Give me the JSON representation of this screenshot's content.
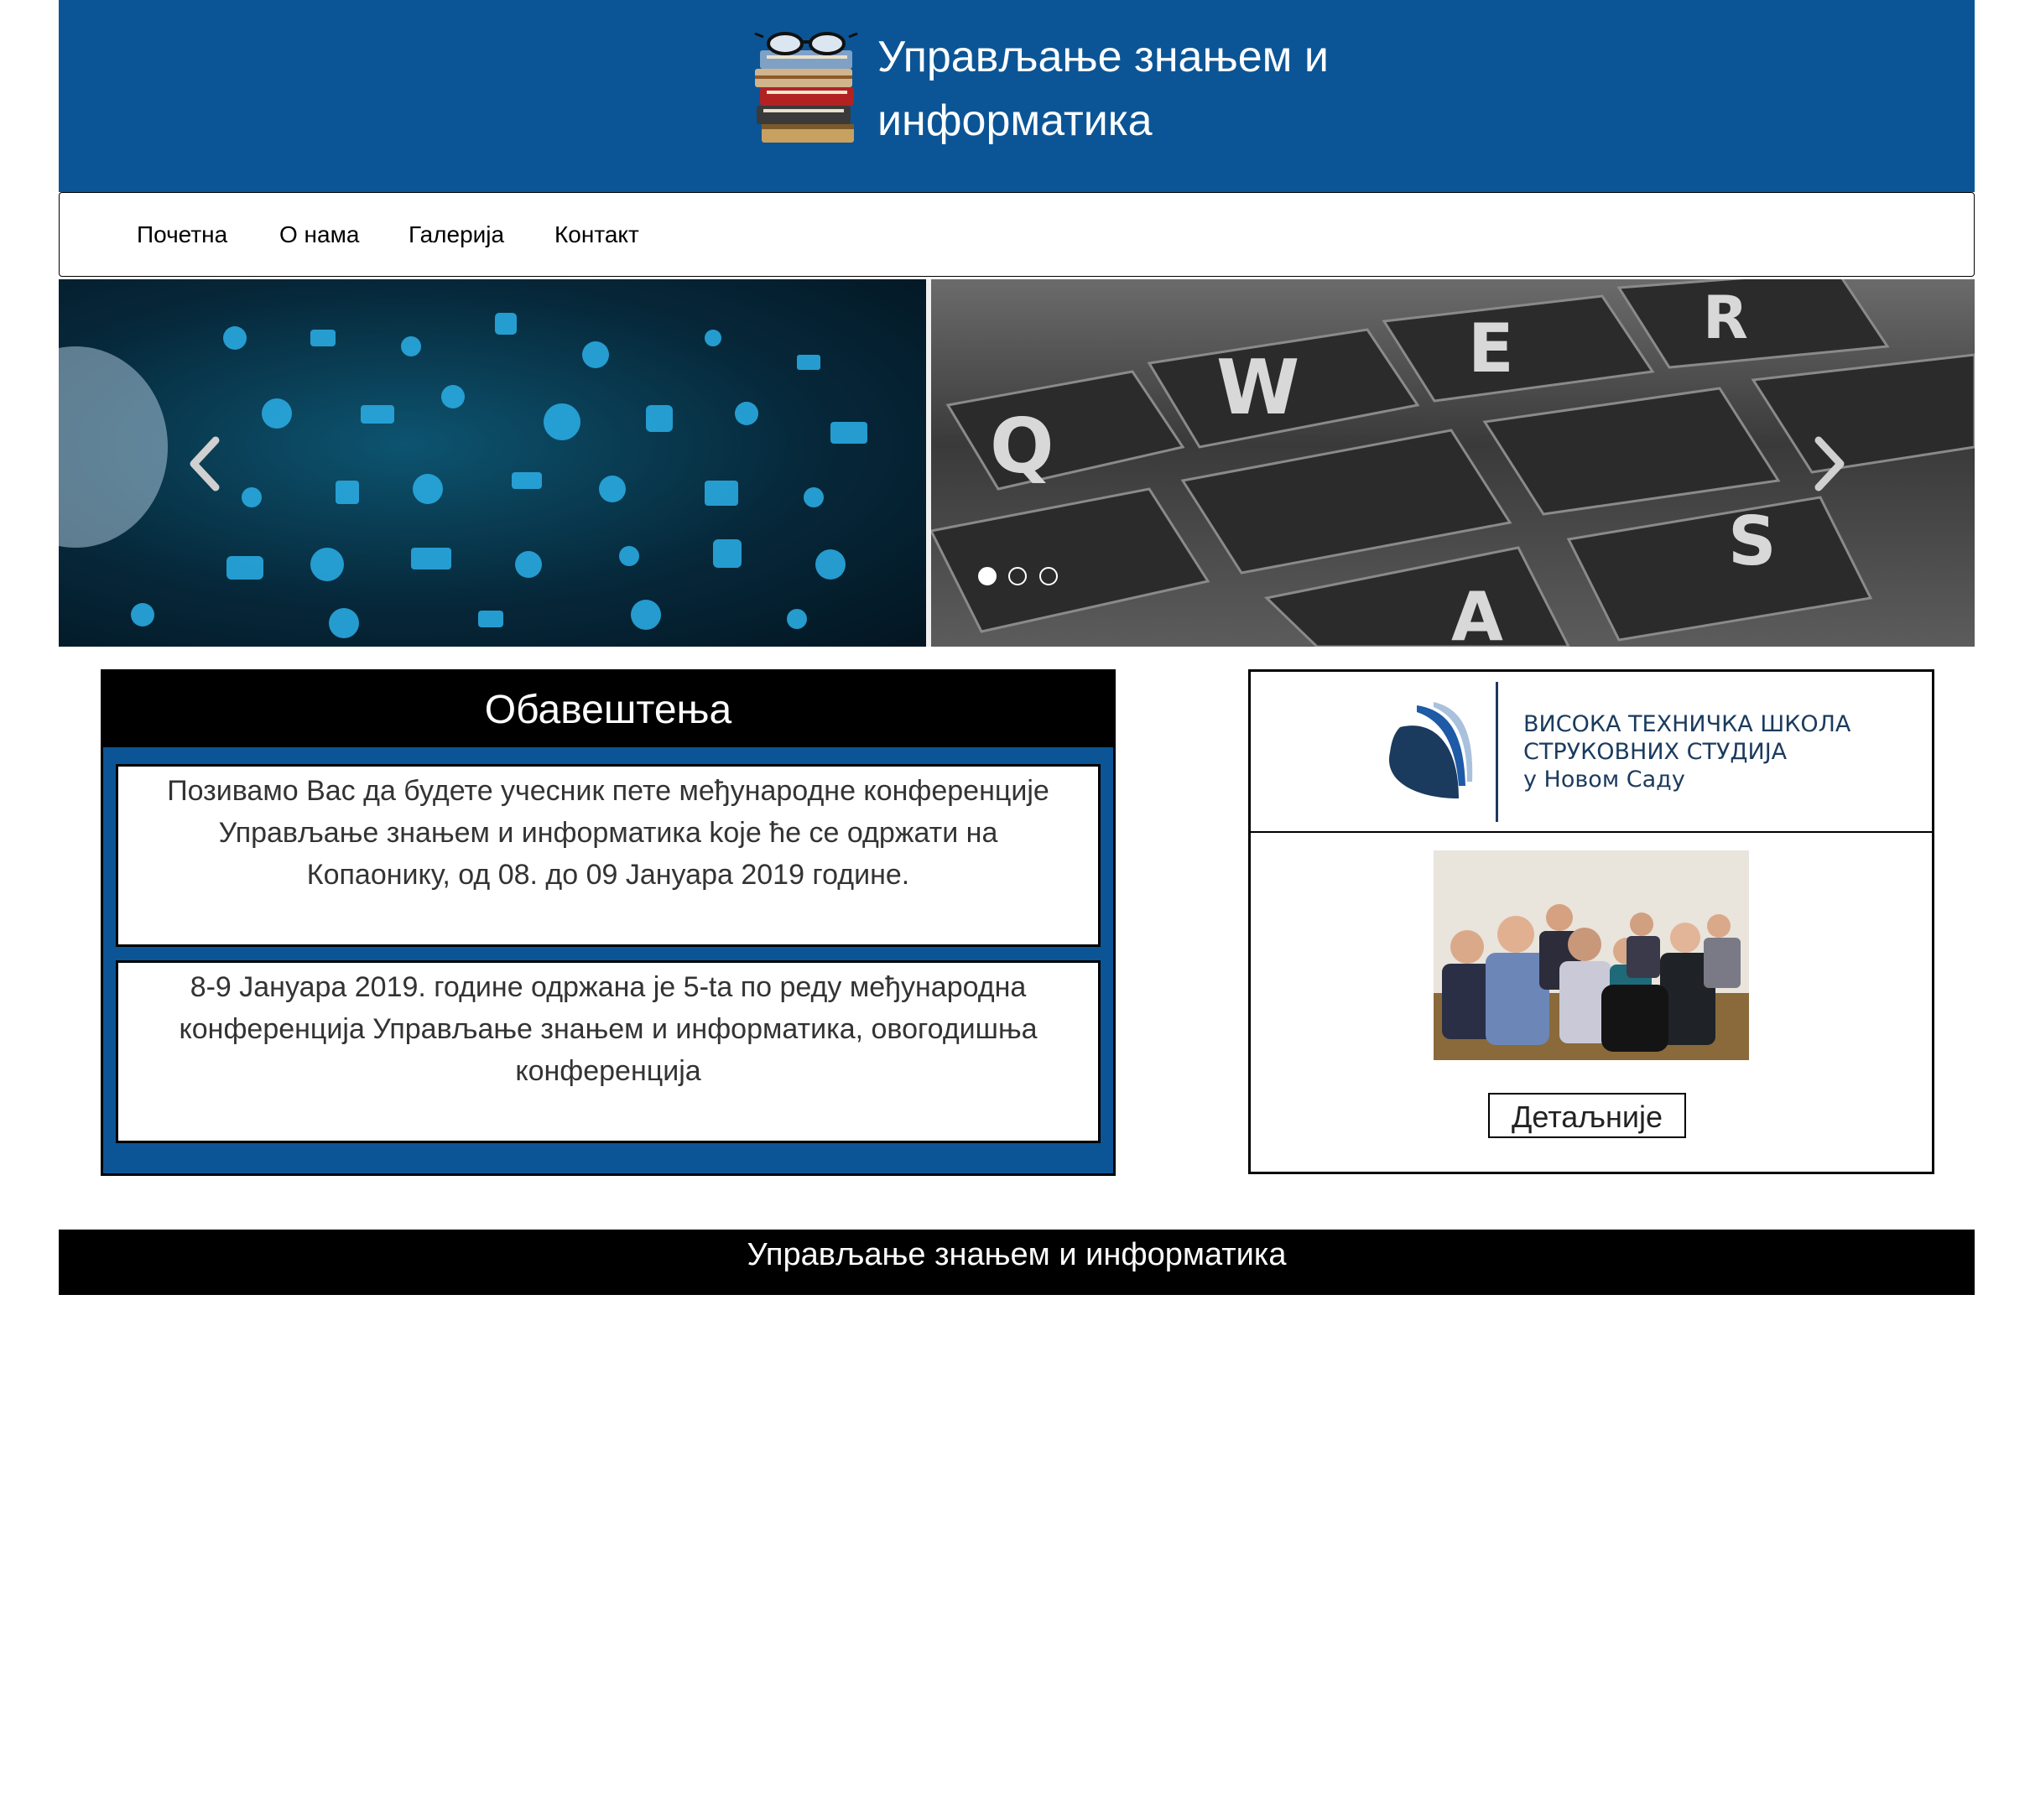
{
  "header": {
    "title": "Управљање знањем и информатика",
    "logo_icon": "books-with-glasses-icon",
    "background_color": "#0b5596"
  },
  "nav": {
    "items": [
      {
        "label": "Почетна"
      },
      {
        "label": "О нама"
      },
      {
        "label": "Галерија"
      },
      {
        "label": "Контакт"
      }
    ]
  },
  "carousel": {
    "slide_count": 3,
    "active_slide": 1,
    "prev_icon": "chevron-left-icon",
    "next_icon": "chevron-right-icon"
  },
  "notices": {
    "heading": "Обавештења",
    "items": [
      {
        "text": "Позивамо Вас да будете учесник пете међународне конференције Управљање знањем и информатика koje ће се одржати на Копаонику, од 08. до 09 Јануара 2019 године."
      },
      {
        "text": "8-9 Јануара 2019. године одржана је 5-ta по реду међународна конференција Управљање знањем и информатика, овогодишња конференција"
      }
    ]
  },
  "side": {
    "school_lines": [
      "ВИСОКА ТЕХНИЧКА ШКОЛА",
      "СТРУКОВНИХ СТУДИЈА",
      "у Новом Саду"
    ],
    "details_label": "Детаљније"
  },
  "footer": {
    "text": "Управљање знањем и информатика"
  },
  "colors": {
    "primary_blue": "#0b5596",
    "black": "#000000",
    "white": "#ffffff"
  }
}
